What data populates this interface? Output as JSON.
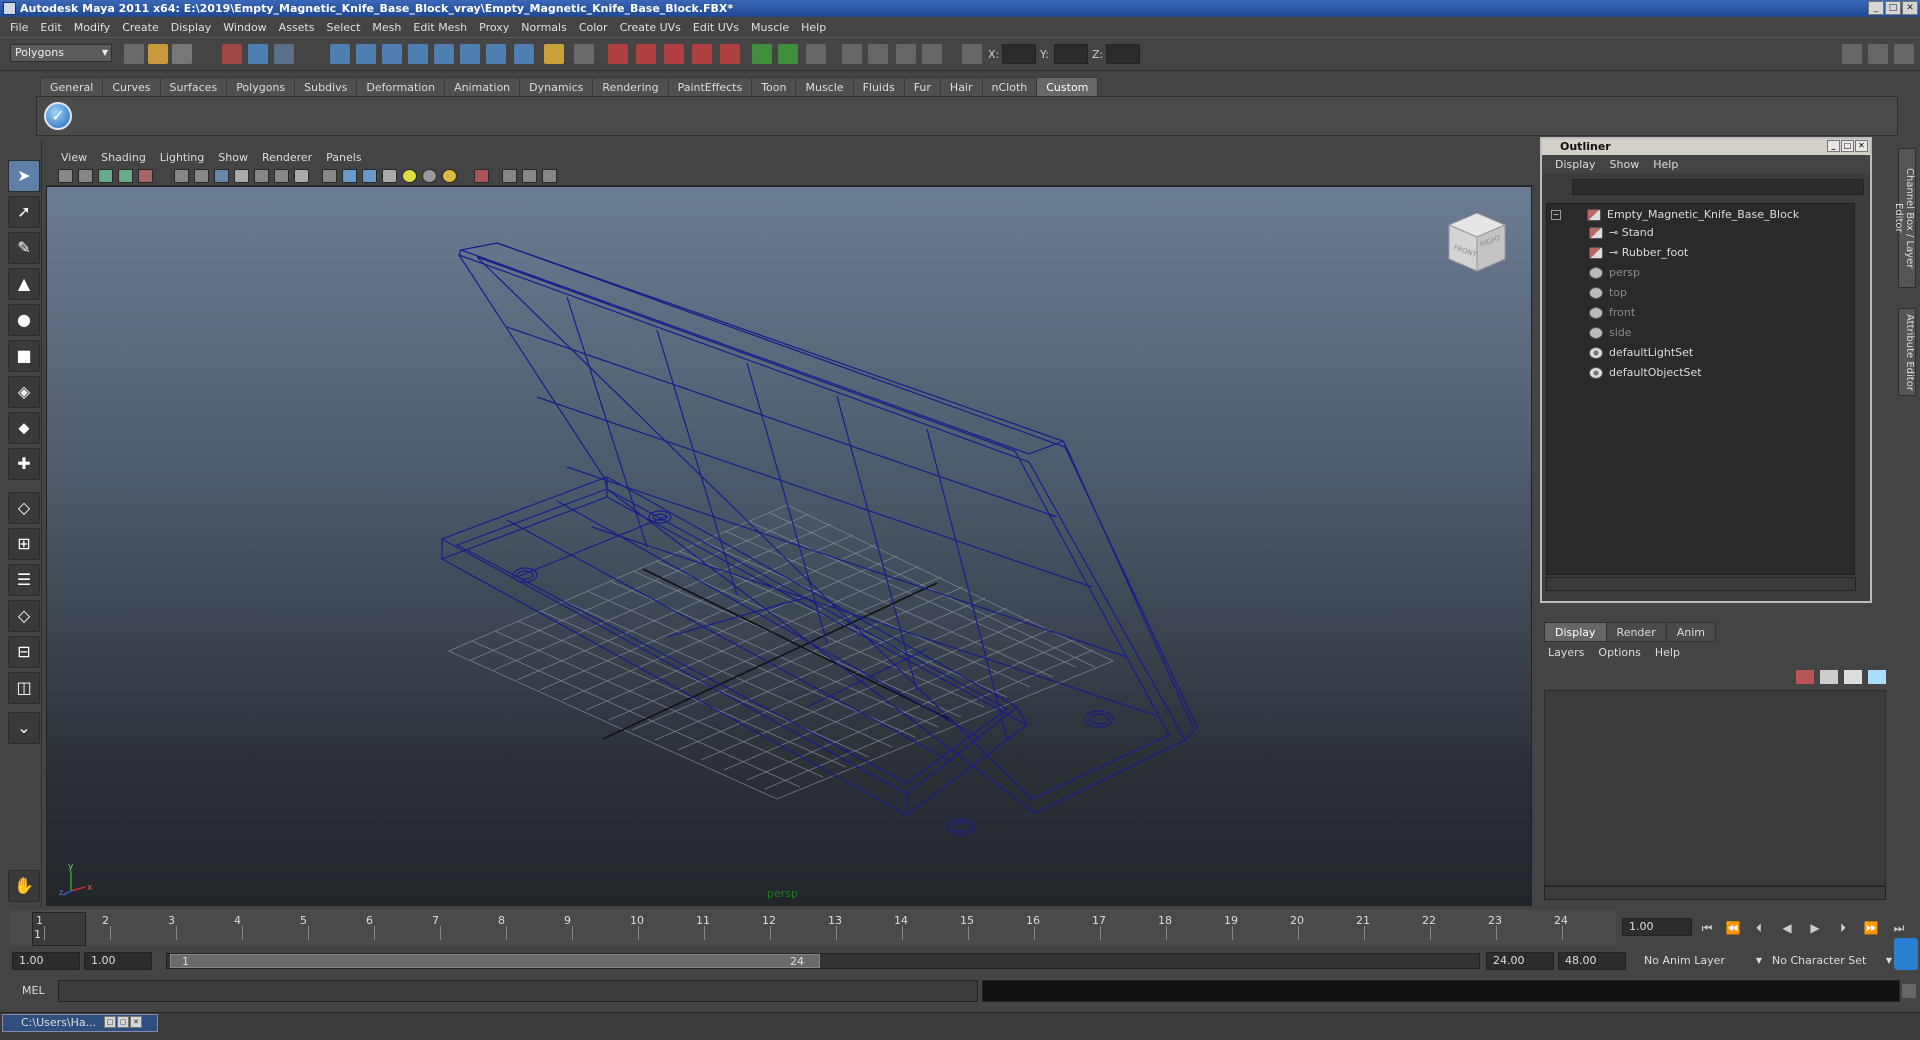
{
  "window": {
    "title": "Autodesk Maya 2011 x64: E:\\2019\\Empty_Magnetic_Knife_Base_Block_vray\\Empty_Magnetic_Knife_Base_Block.FBX*"
  },
  "menubar": [
    "File",
    "Edit",
    "Modify",
    "Create",
    "Display",
    "Window",
    "Assets",
    "Select",
    "Mesh",
    "Edit Mesh",
    "Proxy",
    "Normals",
    "Color",
    "Create UVs",
    "Edit UVs",
    "Muscle",
    "Help"
  ],
  "statusline": {
    "mode": "Polygons",
    "x_label": "X:",
    "y_label": "Y:",
    "z_label": "Z:"
  },
  "shelf": {
    "tabs": [
      "General",
      "Curves",
      "Surfaces",
      "Polygons",
      "Subdivs",
      "Deformation",
      "Animation",
      "Dynamics",
      "Rendering",
      "PaintEffects",
      "Toon",
      "Muscle",
      "Fluids",
      "Fur",
      "Hair",
      "nCloth",
      "Custom"
    ],
    "active_tab": "Custom"
  },
  "viewport": {
    "menu": [
      "View",
      "Shading",
      "Lighting",
      "Show",
      "Renderer",
      "Panels"
    ],
    "camera_label": "persp",
    "cube_front": "FRONT",
    "cube_right": "RIGHT",
    "axis_y": "y",
    "axis_x": "x",
    "axis_z": "z",
    "wire_color": "#1a1a8c"
  },
  "outliner": {
    "title": "Outliner",
    "menu": [
      "Display",
      "Show",
      "Help"
    ],
    "items": [
      {
        "label": "Empty_Magnetic_Knife_Base_Block",
        "dim": false,
        "icon": "mesh-group-icon"
      },
      {
        "label": "Stand",
        "dim": false,
        "icon": "mesh-icon"
      },
      {
        "label": "Rubber_foot",
        "dim": false,
        "icon": "mesh-icon"
      },
      {
        "label": "persp",
        "dim": true,
        "icon": "camera-icon"
      },
      {
        "label": "top",
        "dim": true,
        "icon": "camera-icon"
      },
      {
        "label": "front",
        "dim": true,
        "icon": "camera-icon"
      },
      {
        "label": "side",
        "dim": true,
        "icon": "camera-icon"
      },
      {
        "label": "defaultLightSet",
        "dim": false,
        "icon": "set-icon"
      },
      {
        "label": "defaultObjectSet",
        "dim": false,
        "icon": "set-icon"
      }
    ]
  },
  "side_tabs": [
    "Channel Box / Layer Editor",
    "Attribute Editor"
  ],
  "layer_editor": {
    "tabs": [
      "Display",
      "Render",
      "Anim"
    ],
    "active_tab": "Display",
    "menu": [
      "Layers",
      "Options",
      "Help"
    ]
  },
  "timeline": {
    "ticks": [
      "1",
      "2",
      "3",
      "4",
      "5",
      "6",
      "7",
      "8",
      "9",
      "10",
      "11",
      "12",
      "13",
      "14",
      "15",
      "16",
      "17",
      "18",
      "19",
      "20",
      "21",
      "22",
      "23",
      "24"
    ],
    "current_frame": "1.00",
    "current_marker": "1"
  },
  "range": {
    "start": "1.00",
    "inner_start": "1.00",
    "slider_start": "1",
    "slider_end": "24",
    "end": "24.00",
    "outer_end": "48.00",
    "anim_layer": "No Anim Layer",
    "character_set": "No Character Set"
  },
  "cmdline": {
    "label": "MEL"
  },
  "taskbar": {
    "minimized_window": "C:\\Users\\Ha..."
  }
}
